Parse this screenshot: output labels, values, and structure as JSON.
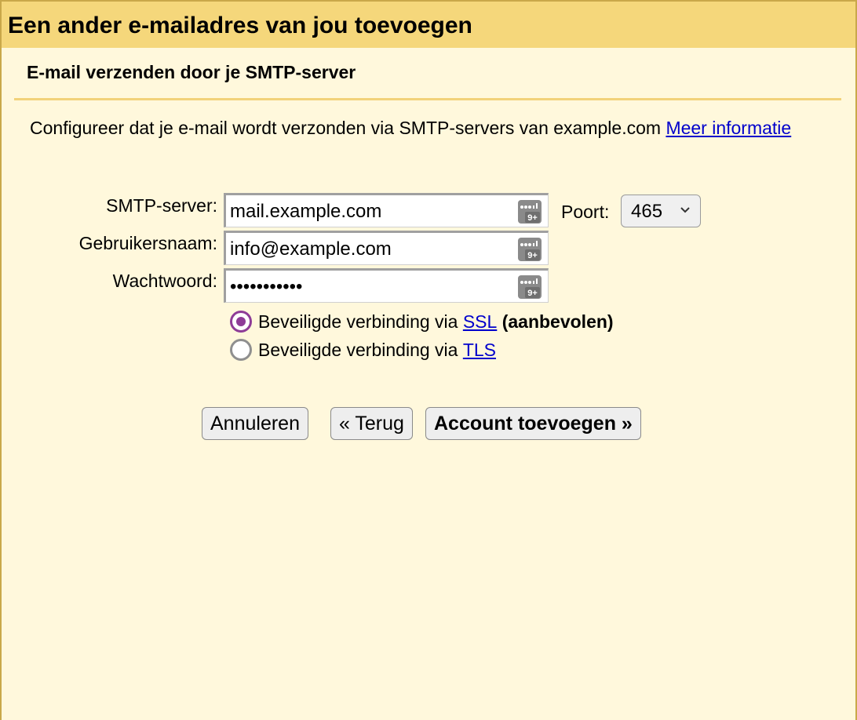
{
  "dialog": {
    "title": "Een ander e-mailadres van jou toevoegen",
    "section_title": "E-mail verzenden door je SMTP-server",
    "intro_text": "Configureer dat je e-mail wordt verzonden via SMTP-servers van example.com ",
    "intro_link": "Meer informatie"
  },
  "form": {
    "smtp_label": "SMTP-server:",
    "smtp_value": "mail.example.com",
    "username_label": "Gebruikersnaam:",
    "username_value": "info@example.com",
    "password_label": "Wachtwoord:",
    "password_value": "•••••••••••",
    "port_label": "Poort:",
    "port_value": "465",
    "password_manager_icon": "password-manager-icon"
  },
  "security": {
    "ssl_text": "Beveiligde verbinding via ",
    "ssl_link": "SSL",
    "ssl_suffix": "(aanbevolen)",
    "ssl_checked": true,
    "tls_text": "Beveiligde verbinding via ",
    "tls_link": "TLS",
    "tls_checked": false
  },
  "buttons": {
    "cancel": "Annuleren",
    "back": "« Terug",
    "add": "Account toevoegen »"
  },
  "colors": {
    "title_bar": "#f5d77b",
    "background": "#fff8dc",
    "radio_accent": "#8e3c97",
    "link": "#0000cc"
  }
}
